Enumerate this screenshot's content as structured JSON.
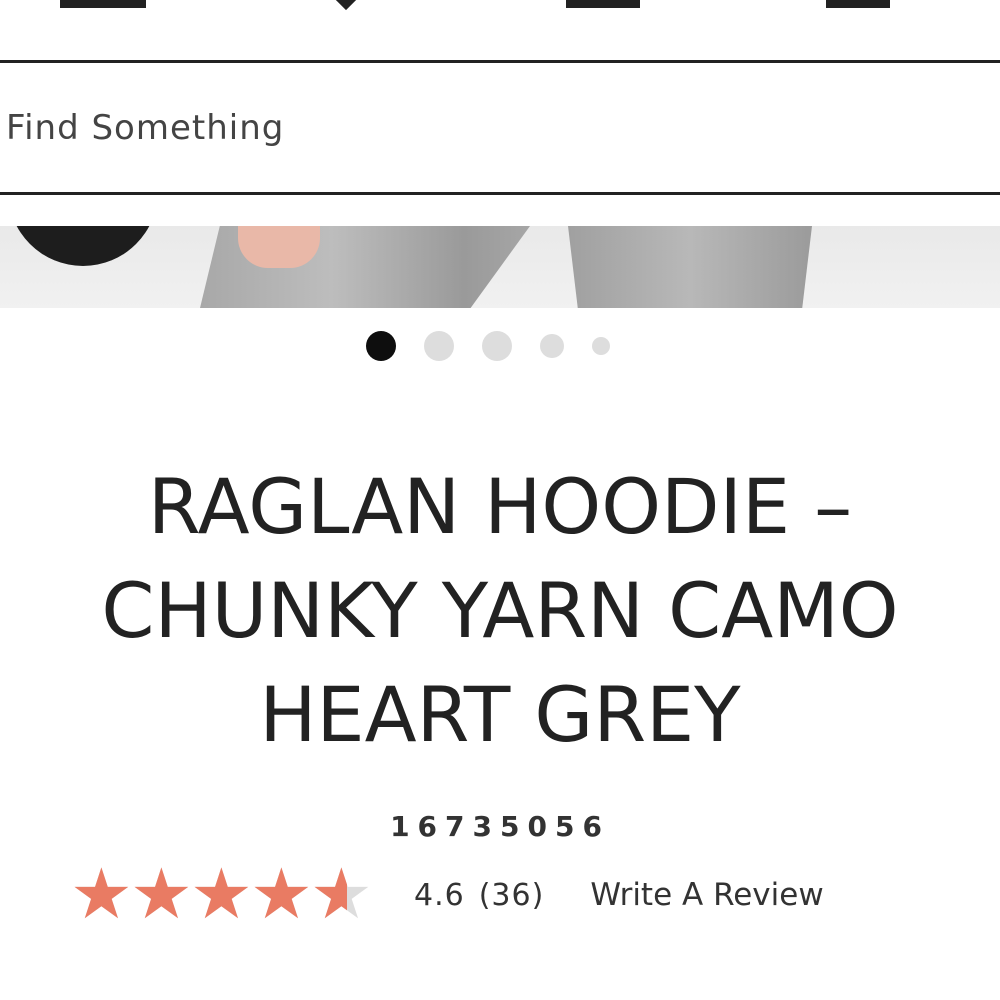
{
  "search": {
    "placeholder": "Find Something"
  },
  "carousel": {
    "total": 5,
    "active": 1
  },
  "product": {
    "title_lines": [
      "RAGLAN HOODIE –",
      "CHUNKY YARN CAMO",
      "HEART GREY"
    ],
    "sku": "16735056",
    "rating": 4.6,
    "rating_label": "4.6",
    "review_count": "(36)",
    "write_review": "Write A Review",
    "star_color": "#e97b63",
    "star_empty_color": "#dddddd"
  }
}
